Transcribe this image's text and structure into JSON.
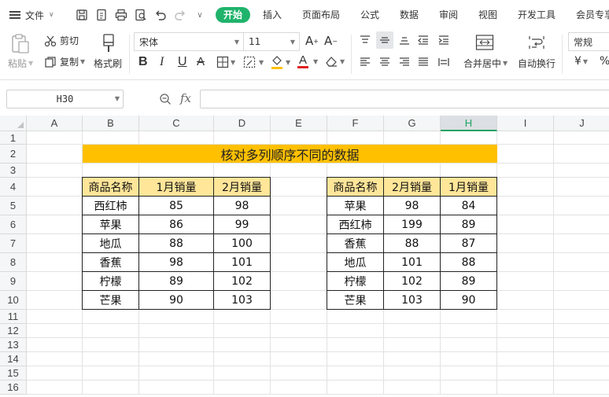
{
  "menubar": {
    "file_label": "文件",
    "tabs": [
      {
        "label": "开始",
        "active": true
      },
      {
        "label": "插入"
      },
      {
        "label": "页面布局"
      },
      {
        "label": "公式"
      },
      {
        "label": "数据"
      },
      {
        "label": "审阅"
      },
      {
        "label": "视图"
      },
      {
        "label": "开发工具"
      },
      {
        "label": "会员专享"
      }
    ]
  },
  "ribbon": {
    "paste_label": "粘贴",
    "cut_label": "剪切",
    "copy_label": "复制",
    "format_painter_label": "格式刷",
    "font_name": "宋体",
    "font_size": "11",
    "merge_center_label": "合并居中",
    "wrap_text_label": "自动换行",
    "number_format": "常规",
    "currency_symbol": "¥",
    "percent_symbol": "%"
  },
  "formula_bar": {
    "cell_ref": "H30",
    "fx_label": "fx",
    "formula": ""
  },
  "sheet": {
    "columns": [
      "A",
      "B",
      "C",
      "D",
      "E",
      "F",
      "G",
      "H",
      "I",
      "J"
    ],
    "selected_column": "H",
    "rows": [
      "1",
      "2",
      "3",
      "4",
      "5",
      "6",
      "7",
      "8",
      "9",
      "10",
      "11",
      "12",
      "13",
      "14",
      "15",
      "16"
    ],
    "title": "核对多列顺序不同的数据",
    "title_color": "#ffc000",
    "header_fill": "#ffe699",
    "left_table": {
      "headers": [
        "商品名称",
        "1月销量",
        "2月销量"
      ],
      "rows": [
        [
          "西红柿",
          "85",
          "98"
        ],
        [
          "苹果",
          "86",
          "99"
        ],
        [
          "地瓜",
          "88",
          "100"
        ],
        [
          "香蕉",
          "98",
          "101"
        ],
        [
          "柠檬",
          "89",
          "102"
        ],
        [
          "芒果",
          "90",
          "103"
        ]
      ]
    },
    "right_table": {
      "headers": [
        "商品名称",
        "2月销量",
        "1月销量"
      ],
      "rows": [
        [
          "苹果",
          "98",
          "84"
        ],
        [
          "西红柿",
          "199",
          "89"
        ],
        [
          "香蕉",
          "88",
          "87"
        ],
        [
          "地瓜",
          "101",
          "88"
        ],
        [
          "柠檬",
          "102",
          "89"
        ],
        [
          "芒果",
          "103",
          "90"
        ]
      ]
    }
  }
}
